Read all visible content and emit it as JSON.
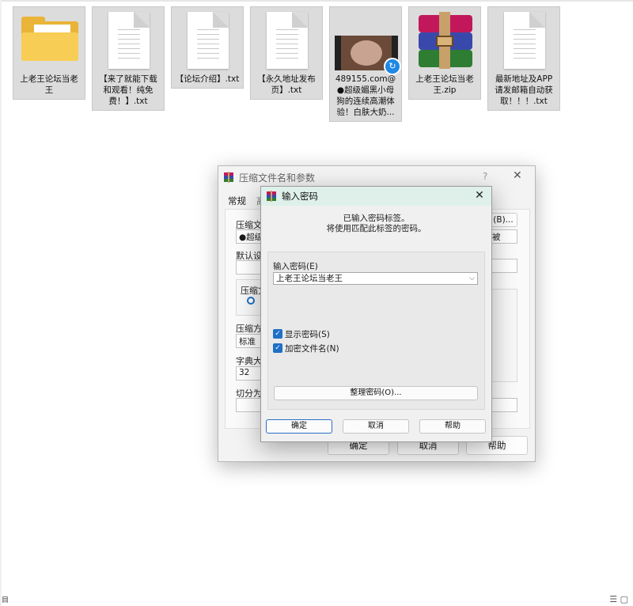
{
  "files": [
    {
      "label": "上老王论坛当老王",
      "icon": "folder-icon"
    },
    {
      "label": "【来了就能下载和观看！纯免费！】.txt",
      "icon": "text-file-icon"
    },
    {
      "label": "【论坛介绍】.txt",
      "icon": "text-file-icon"
    },
    {
      "label": "【永久地址发布页】.txt",
      "icon": "text-file-icon"
    },
    {
      "label": "489155.com@●超级媚黑小母狗的连续高潮体验！白肤大奶...",
      "icon": "video-file-icon"
    },
    {
      "label": "上老王论坛当老王.zip",
      "icon": "winrar-archive-icon"
    },
    {
      "label": "最新地址及APP请发邮箱自动获取！！！.txt",
      "icon": "text-file-icon"
    }
  ],
  "archive_dialog": {
    "title": "压缩文件名和参数",
    "help_glyph": "?",
    "close_glyph": "✕",
    "tab_general": "常规",
    "tab_second": "高",
    "filename_label": "压缩文件",
    "filename_value": "●超级",
    "browse_button": "(B)...",
    "update_value": "被",
    "default_label": "默认设",
    "format_label": "压缩文",
    "method_label": "压缩方",
    "method_value": "标准",
    "dict_label": "字典大小",
    "dict_value": "32",
    "split_label": "切分为",
    "ok_button": "确定",
    "cancel_button": "取消",
    "help_button": "帮助"
  },
  "password_dialog": {
    "title": "输入密码",
    "close_glyph": "✕",
    "message_line1": "已输入密码标签。",
    "message_line2": "将使用匹配此标签的密码。",
    "password_label": "输入密码(E)",
    "password_value": "上老王论坛当老王",
    "show_password_label": "显示密码(S)",
    "show_password_checked": true,
    "encrypt_names_label": "加密文件名(N)",
    "encrypt_names_checked": true,
    "organize_button": "整理密码(O)...",
    "ok_button": "确定",
    "cancel_button": "取消",
    "help_button": "帮助",
    "accent_color": "#1f6fc7"
  },
  "status_left": "目",
  "status_right_icon": "list-view-icon"
}
